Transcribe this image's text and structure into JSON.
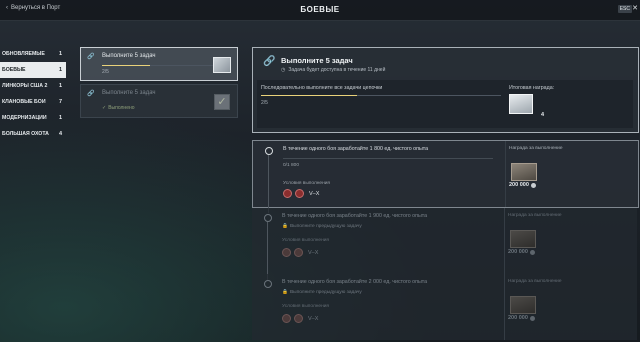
{
  "header": {
    "back_label": "Вернуться в Порт",
    "title": "БОЕВЫЕ",
    "esc_label": "ESC",
    "close_glyph": "✕"
  },
  "sidebar": {
    "items": [
      {
        "label": "ОБНОВЛЯЕМЫЕ",
        "count": "1"
      },
      {
        "label": "БОЕВЫЕ",
        "count": "1"
      },
      {
        "label": "ЛИНКОРЫ США 2",
        "count": "1"
      },
      {
        "label": "КЛАНОВЫЕ БОИ",
        "count": "7"
      },
      {
        "label": "МОДЕРНИЗАЦИИ",
        "count": "1"
      },
      {
        "label": "БОЛЬШАЯ ОХОТА",
        "count": "4"
      }
    ]
  },
  "task_list": [
    {
      "name": "Выполните 5 задач",
      "progress_text": "2/5",
      "progress": 0.4,
      "selected": true
    },
    {
      "name": "Выполните 5 задач",
      "status": "Выполнено",
      "selected": false
    }
  ],
  "detail": {
    "title": "Выполните 5 задач",
    "subtitle": "Задача будет доступна в течение 11 дней",
    "chain_label": "Последовательно выполните все задачи цепочки",
    "chain_progress_text": "2/5",
    "chain_progress": 0.4,
    "reward_label": "Итоговая награда:",
    "reward_count": "4"
  },
  "subtasks": [
    {
      "title": "В течение одного боя заработайте 1 800 ед. чистого опыта",
      "progress_text": "0/1 800",
      "condition_label": "Условия выполнения",
      "tier": "V–X",
      "reward_label": "Награда за выполнение",
      "reward_amount": "200 000",
      "locked": false
    },
    {
      "title": "В течение одного боя заработайте 1 900 ед. чистого опыта",
      "lock_text": "Выполните предыдущую задачу",
      "condition_label": "Условия выполнения",
      "tier": "V–X",
      "reward_label": "Награда за выполнение",
      "reward_amount": "200 000",
      "locked": true
    },
    {
      "title": "В течение одного боя заработайте 2 000 ед. чистого опыта",
      "lock_text": "Выполните предыдущую задачу",
      "condition_label": "Условия выполнения",
      "tier": "V–X",
      "reward_label": "Награда за выполнение",
      "reward_amount": "200 000",
      "locked": true
    }
  ],
  "icons": {
    "back": "chevron-left-icon",
    "link": "link-icon",
    "clock": "clock-icon",
    "lock": "lock-icon",
    "check": "check-icon",
    "credits": "credits-icon"
  }
}
